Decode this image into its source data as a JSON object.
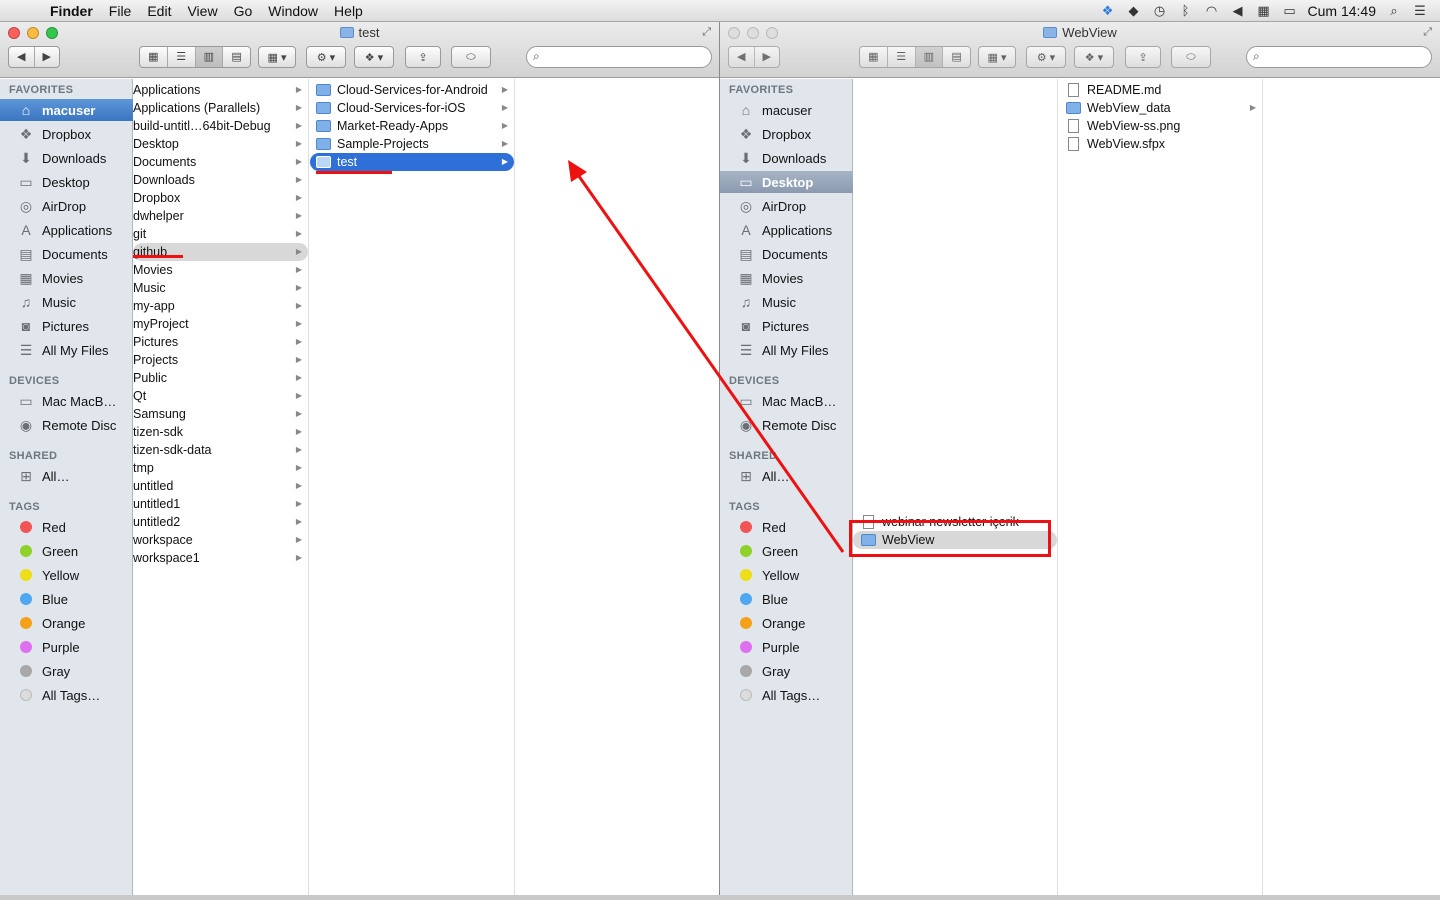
{
  "menubar": {
    "app": "Finder",
    "menus": [
      "File",
      "Edit",
      "View",
      "Go",
      "Window",
      "Help"
    ],
    "clock": "Cum 14:49"
  },
  "left_window": {
    "title": "test",
    "sidebar": {
      "favorites_header": "FAVORITES",
      "favorites": [
        "macuser",
        "Dropbox",
        "Downloads",
        "Desktop",
        "AirDrop",
        "Applications",
        "Documents",
        "Movies",
        "Music",
        "Pictures",
        "All My Files"
      ],
      "selected": "macuser",
      "devices_header": "DEVICES",
      "devices": [
        "Mac MacB…",
        "Remote Disc"
      ],
      "shared_header": "SHARED",
      "shared": [
        "All…"
      ],
      "tags_header": "TAGS",
      "tags": [
        "Red",
        "Green",
        "Yellow",
        "Blue",
        "Orange",
        "Purple",
        "Gray",
        "All Tags…"
      ]
    },
    "column1": [
      "Applications",
      "Applications (Parallels)",
      "build-untitl…64bit-Debug",
      "Desktop",
      "Documents",
      "Downloads",
      "Dropbox",
      "dwhelper",
      "git",
      "github",
      "Movies",
      "Music",
      "my-app",
      "myProject",
      "Pictures",
      "Projects",
      "Public",
      "Qt",
      "Samsung",
      "tizen-sdk",
      "tizen-sdk-data",
      "tmp",
      "untitled",
      "untitled1",
      "untitled2",
      "workspace",
      "workspace1"
    ],
    "column1_highlighted": "github",
    "column2": [
      "Cloud-Services-for-Android",
      "Cloud-Services-for-iOS",
      "Market-Ready-Apps",
      "Sample-Projects",
      "test"
    ],
    "column2_selected": "test"
  },
  "right_window": {
    "title": "WebView",
    "sidebar": {
      "favorites_header": "FAVORITES",
      "favorites": [
        "macuser",
        "Dropbox",
        "Downloads",
        "Desktop",
        "AirDrop",
        "Applications",
        "Documents",
        "Movies",
        "Music",
        "Pictures",
        "All My Files"
      ],
      "selected": "Desktop",
      "devices_header": "DEVICES",
      "devices": [
        "Mac MacB…",
        "Remote Disc"
      ],
      "shared_header": "SHARED",
      "shared": [
        "All…"
      ],
      "tags_header": "TAGS",
      "tags": [
        "Red",
        "Green",
        "Yellow",
        "Blue",
        "Orange",
        "Purple",
        "Gray",
        "All Tags…"
      ]
    },
    "column1": [
      "webinar newsletter içerik",
      "WebView"
    ],
    "column1_highlighted": "WebView",
    "column2": [
      "README.md",
      "WebView_data",
      "WebView-ss.png",
      "WebView.sfpx"
    ]
  },
  "tag_colors": {
    "Red": "#f05454",
    "Green": "#8ed22a",
    "Yellow": "#ecdf18",
    "Blue": "#4fa7ef",
    "Orange": "#f7a01c",
    "Purple": "#e06ef0",
    "Gray": "#a8a8a8",
    "All Tags…": "#dcdcdc"
  },
  "annotation_color": "#e11111"
}
